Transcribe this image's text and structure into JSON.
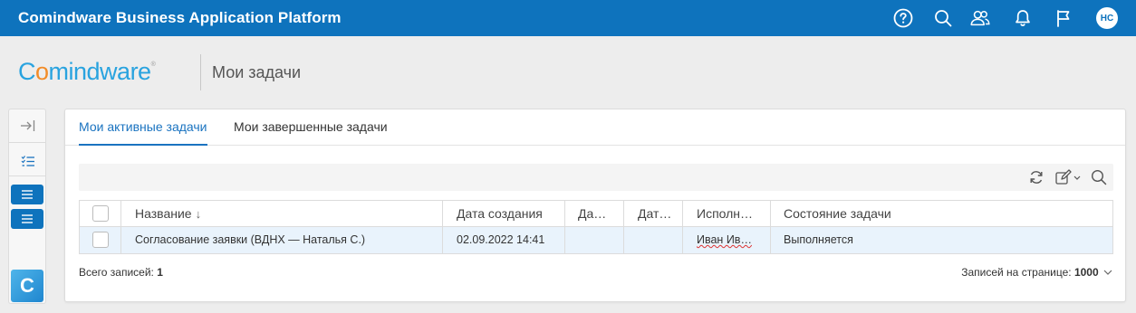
{
  "topbar": {
    "title": "Comindware Business Application Platform",
    "icons": [
      "help-icon",
      "search-icon",
      "users-icon",
      "bell-icon",
      "flag-icon"
    ],
    "avatar": "НС"
  },
  "header": {
    "logo_parts": [
      "C",
      "o",
      "mindware"
    ],
    "logo_reg": "®",
    "page_title": "Мои задачи"
  },
  "sidebar": {
    "items": [
      "expand-icon",
      "task-list-icon",
      "menu-icon",
      "menu-icon"
    ],
    "logo_letter": "C"
  },
  "tabs": [
    {
      "label": "Мои активные задачи",
      "active": true
    },
    {
      "label": "Мои завершенные задачи",
      "active": false
    }
  ],
  "toolbar": {
    "icons": [
      "refresh-icon",
      "edit-icon",
      "search-icon"
    ]
  },
  "table": {
    "columns": [
      "Название",
      "Дата создания",
      "Да…",
      "Дат…",
      "Исполн…",
      "Состояние задачи"
    ],
    "sort_indicator": "↓",
    "rows": [
      [
        "Согласование заявки (ВДНХ — Наталья С.)",
        "02.09.2022 14:41",
        "",
        "",
        "Иван Ив…",
        "Выполняется"
      ]
    ]
  },
  "footer": {
    "total_label": "Всего записей:",
    "total_value": "1",
    "page_size_label": "Записей на странице:",
    "page_size_value": "1000"
  },
  "colors": {
    "topbar": "#0e73bd",
    "accent": "#1a73c0",
    "selected_row": "#e9f3fc",
    "logo_blue": "#29a3df",
    "logo_orange": "#f28c28"
  }
}
